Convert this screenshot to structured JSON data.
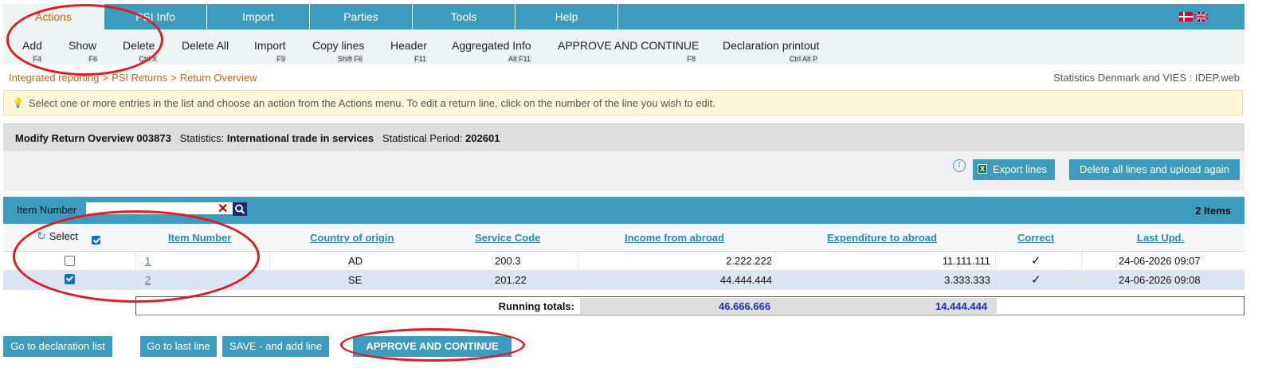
{
  "menu": {
    "tabs": [
      {
        "label": "Actions",
        "active": true
      },
      {
        "label": "PSI Info",
        "active": false
      },
      {
        "label": "Import",
        "active": false
      },
      {
        "label": "Parties",
        "active": false
      },
      {
        "label": "Tools",
        "active": false
      },
      {
        "label": "Help",
        "active": false
      }
    ],
    "flags": [
      "danish-flag-icon",
      "uk-flag-icon"
    ]
  },
  "toolbar": {
    "actions": [
      {
        "label": "Add",
        "shortcut": "F4"
      },
      {
        "label": "Show",
        "shortcut": "F6"
      },
      {
        "label": "Delete",
        "shortcut": "Ctrl X"
      },
      {
        "label": "Delete All",
        "shortcut": ""
      },
      {
        "label": "Import",
        "shortcut": "F9"
      },
      {
        "label": "Copy lines",
        "shortcut": "Shift F6"
      },
      {
        "label": "Header",
        "shortcut": "F11"
      },
      {
        "label": "Aggregated Info",
        "shortcut": "Alt F11"
      },
      {
        "label": "APPROVE AND CONTINUE",
        "shortcut": "F8"
      },
      {
        "label": "Declaration printout",
        "shortcut": "Ctrl Alt P"
      }
    ]
  },
  "breadcrumb": {
    "items": [
      "Integrated reporting",
      "PSI Returns",
      "Return Overview"
    ],
    "separator": ">"
  },
  "app_name": "Statistics Denmark and VIES : IDEP.web",
  "info_message": "Select one or more entries in the list and choose an action from the Actions menu. To edit a return line, click on the number of the line you wish to edit.",
  "panel": {
    "title": "Modify Return Overview 003873",
    "statistics_label": "Statistics:",
    "statistics_value": "International trade in services",
    "period_label": "Statistical Period:",
    "period_value": "202601",
    "export_label": "Export lines",
    "delete_all_upload_label": "Delete all lines and upload again"
  },
  "filter": {
    "label": "Item Number",
    "value": "",
    "count_label": "2 Items"
  },
  "table": {
    "select_label": "Select",
    "columns": [
      "Item Number",
      "Country of origin",
      "Service Code",
      "Income from abroad",
      "Expenditure to abroad",
      "Correct",
      "Last Upd."
    ],
    "rows": [
      {
        "selected": false,
        "item": "1",
        "country": "AD",
        "service": "200.3",
        "income": "2.222.222",
        "expenditure": "11.111.111",
        "correct": "✓",
        "updated": "24-06-2026 09:07"
      },
      {
        "selected": true,
        "item": "2",
        "country": "SE",
        "service": "201.22",
        "income": "44.444.444",
        "expenditure": "3.333.333",
        "correct": "✓",
        "updated": "24-06-2026 09:08"
      }
    ],
    "totals_label": "Running totals:",
    "total_income": "46.666.666",
    "total_expenditure": "14.444.444"
  },
  "bottom_buttons": {
    "declaration_list": "Go to declaration list",
    "last_line": "Go to last line",
    "save_add": "SAVE - and add line",
    "approve": "APPROVE AND CONTINUE"
  },
  "colors": {
    "accent": "#3d9bbe",
    "link": "#2b8ab0",
    "active_tab_text": "#c9660f",
    "annotation": "#e01b24",
    "totals_value": "#1f2fb5"
  }
}
